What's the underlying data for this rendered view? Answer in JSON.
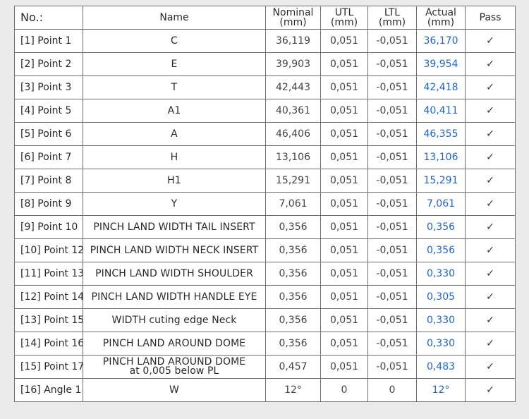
{
  "table": {
    "headers": {
      "no": "No.:",
      "name": "Name",
      "nominal": [
        "Nominal",
        "(mm)"
      ],
      "utl": [
        "UTL",
        "(mm)"
      ],
      "ltl": [
        "LTL",
        "(mm)"
      ],
      "actual": [
        "Actual",
        "(mm)"
      ],
      "pass": "Pass"
    },
    "rows": [
      {
        "no": "[1] Point 1",
        "name": [
          "C"
        ],
        "nominal": "36,119",
        "utl": "0,051",
        "ltl": "-0,051",
        "actual": "36,170",
        "pass": "✓"
      },
      {
        "no": "[2] Point 2",
        "name": [
          "E"
        ],
        "nominal": "39,903",
        "utl": "0,051",
        "ltl": "-0,051",
        "actual": "39,954",
        "pass": "✓"
      },
      {
        "no": "[3] Point 3",
        "name": [
          "T"
        ],
        "nominal": "42,443",
        "utl": "0,051",
        "ltl": "-0,051",
        "actual": "42,418",
        "pass": "✓"
      },
      {
        "no": "[4] Point 5",
        "name": [
          "A1"
        ],
        "nominal": "40,361",
        "utl": "0,051",
        "ltl": "-0,051",
        "actual": "40,411",
        "pass": "✓"
      },
      {
        "no": "[5] Point 6",
        "name": [
          "A"
        ],
        "nominal": "46,406",
        "utl": "0,051",
        "ltl": "-0,051",
        "actual": "46,355",
        "pass": "✓"
      },
      {
        "no": "[6] Point 7",
        "name": [
          "H"
        ],
        "nominal": "13,106",
        "utl": "0,051",
        "ltl": "-0,051",
        "actual": "13,106",
        "pass": "✓"
      },
      {
        "no": "[7] Point 8",
        "name": [
          "H1"
        ],
        "nominal": "15,291",
        "utl": "0,051",
        "ltl": "-0,051",
        "actual": "15,291",
        "pass": "✓"
      },
      {
        "no": "[8] Point 9",
        "name": [
          "Y"
        ],
        "nominal": "7,061",
        "utl": "0,051",
        "ltl": "-0,051",
        "actual": "7,061",
        "pass": "✓"
      },
      {
        "no": "[9] Point 10",
        "name": [
          "PINCH LAND WIDTH TAIL INSERT"
        ],
        "nominal": "0,356",
        "utl": "0,051",
        "ltl": "-0,051",
        "actual": "0,356",
        "pass": "✓"
      },
      {
        "no": "[10] Point 12",
        "name": [
          "PINCH LAND WIDTH NECK INSERT"
        ],
        "nominal": "0,356",
        "utl": "0,051",
        "ltl": "-0,051",
        "actual": "0,356",
        "pass": "✓"
      },
      {
        "no": "[11] Point 13",
        "name": [
          "PINCH LAND WIDTH SHOULDER"
        ],
        "nominal": "0,356",
        "utl": "0,051",
        "ltl": "-0,051",
        "actual": "0,330",
        "pass": "✓"
      },
      {
        "no": "[12] Point 14",
        "name": [
          "PINCH LAND WIDTH HANDLE EYE"
        ],
        "nominal": "0,356",
        "utl": "0,051",
        "ltl": "-0,051",
        "actual": "0,305",
        "pass": "✓"
      },
      {
        "no": "[13] Point 15",
        "name": [
          "WIDTH cuting edge Neck"
        ],
        "nominal": "0,356",
        "utl": "0,051",
        "ltl": "-0,051",
        "actual": "0,330",
        "pass": "✓"
      },
      {
        "no": "[14] Point 16",
        "name": [
          "PINCH LAND AROUND DOME"
        ],
        "nominal": "0,356",
        "utl": "0,051",
        "ltl": "-0,051",
        "actual": "0,330",
        "pass": "✓"
      },
      {
        "no": "[15] Point 17",
        "name": [
          "PINCH LAND AROUND DOME",
          "at 0,005 below PL"
        ],
        "nominal": "0,457",
        "utl": "0,051",
        "ltl": "-0,051",
        "actual": "0,483",
        "pass": "✓"
      },
      {
        "no": "[16] Angle 1",
        "name": [
          "W"
        ],
        "nominal": "12°",
        "utl": "0",
        "ltl": "0",
        "actual": "12°",
        "pass": "✓"
      }
    ]
  }
}
